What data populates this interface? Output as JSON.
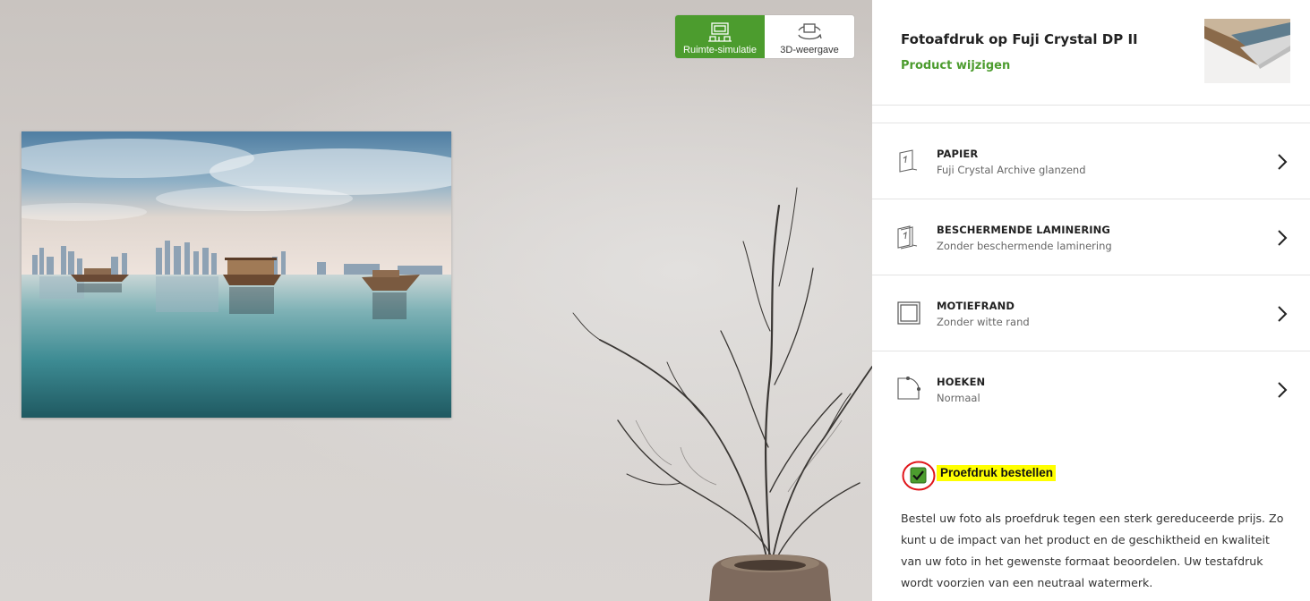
{
  "view_toggle": {
    "room_label": "Ruimte-simulatie",
    "view3d_label": "3D-weergave",
    "active": "room"
  },
  "product": {
    "title": "Fotoafdruk op Fuji Crystal DP II",
    "change_label": "Product wijzigen"
  },
  "options": [
    {
      "title": "PAPIER",
      "value": "Fuji Crystal Archive glanzend",
      "icon": "paper-icon"
    },
    {
      "title": "BESCHERMENDE LAMINERING",
      "value": "Zonder beschermende laminering",
      "icon": "lamination-icon"
    },
    {
      "title": "MOTIEFRAND",
      "value": "Zonder witte rand",
      "icon": "border-frame-icon"
    },
    {
      "title": "HOEKEN",
      "value": "Normaal",
      "icon": "corner-icon"
    }
  ],
  "proof": {
    "label": "Proefdruk bestellen",
    "checked": true,
    "description": "Bestel uw foto als proefdruk tegen een sterk gereduceerde prijs. Zo kunt u de impact van het product en de geschiktheid en kwaliteit van uw foto in het gewenste formaat beoordelen. Uw testafdruk wordt voorzien van een neutraal watermerk."
  },
  "colors": {
    "accent": "#4c9c2e",
    "highlight": "#ffff00",
    "annotation": "#e0161b"
  }
}
